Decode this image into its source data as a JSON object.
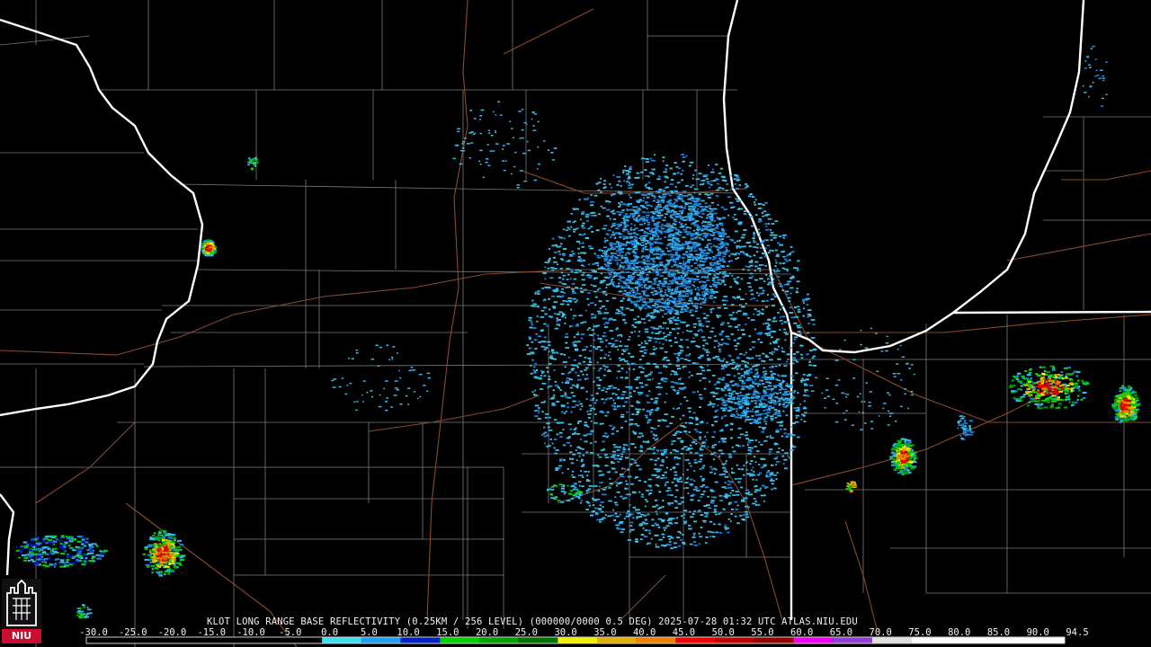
{
  "caption": {
    "text": "KLOT LONG RANGE BASE REFLECTIVITY (0.25KM / 256 LEVEL) (000000/0000 0.5 DEG) 2025-07-28 01:32 UTC  ATLAS.NIU.EDU"
  },
  "scale": {
    "labels": [
      "-30.0",
      "-25.0",
      "-20.0",
      "-15.0",
      "-10.0",
      "-5.0",
      "0.0",
      "5.0",
      "10.0",
      "15.0",
      "20.0",
      "25.0",
      "30.0",
      "35.0",
      "40.0",
      "45.0",
      "50.0",
      "55.0",
      "60.0",
      "65.0",
      "70.0",
      "75.0",
      "80.0",
      "85.0",
      "90.0",
      "94.5"
    ],
    "min": -30,
    "max": 94.5,
    "stops": [
      {
        "dbz": -30,
        "color": "#000000"
      },
      {
        "dbz": 0,
        "color": "#000000"
      },
      {
        "dbz": 5,
        "color": "#40e0f0"
      },
      {
        "dbz": 10,
        "color": "#1fa0f0"
      },
      {
        "dbz": 15,
        "color": "#0020c0"
      },
      {
        "dbz": 20,
        "color": "#00d000"
      },
      {
        "dbz": 25,
        "color": "#00a000"
      },
      {
        "dbz": 30,
        "color": "#007000"
      },
      {
        "dbz": 35,
        "color": "#f0f000"
      },
      {
        "dbz": 40,
        "color": "#e0b000"
      },
      {
        "dbz": 45,
        "color": "#f08000"
      },
      {
        "dbz": 50,
        "color": "#f00000"
      },
      {
        "dbz": 55,
        "color": "#c00000"
      },
      {
        "dbz": 60,
        "color": "#900000"
      },
      {
        "dbz": 65,
        "color": "#f000f0"
      },
      {
        "dbz": 70,
        "color": "#9040d0"
      },
      {
        "dbz": 75,
        "color": "#e0e0e0"
      },
      {
        "dbz": 94.5,
        "color": "#ffffff"
      }
    ]
  },
  "logo": {
    "text": "NIU",
    "color": "#c8102e"
  },
  "colors": {
    "state_border": "#ffffff",
    "county_line": "#7a7a7a",
    "highway": "#8b4a2b",
    "light_echo": "#3ab8e6",
    "medium_echo": "#1e7fd8"
  }
}
